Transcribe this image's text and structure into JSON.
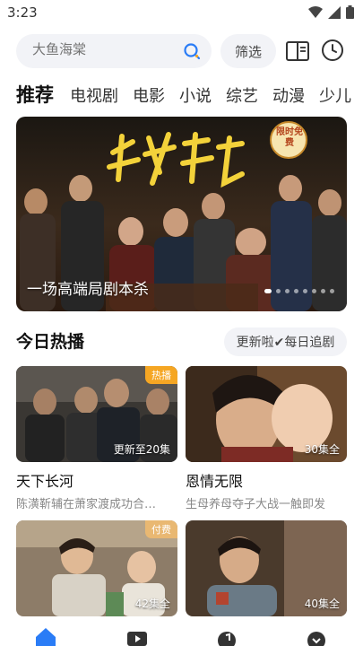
{
  "status": {
    "time": "3:23"
  },
  "search": {
    "placeholder": "大鱼海棠"
  },
  "toolbar": {
    "filter_label": "筛选"
  },
  "tabs": [
    {
      "label": "推荐",
      "active": true
    },
    {
      "label": "电视剧"
    },
    {
      "label": "电影"
    },
    {
      "label": "小说"
    },
    {
      "label": "综艺"
    },
    {
      "label": "动漫"
    },
    {
      "label": "少儿"
    }
  ],
  "banner": {
    "title_art": "扬名立万",
    "badge": "限时免费",
    "caption": "一场高端局剧本杀"
  },
  "section": {
    "title": "今日热播",
    "action_label": "更新啦✔每日追剧"
  },
  "cards": [
    {
      "title": "天下长河",
      "desc": "陈潢靳辅在萧家渡成功合…",
      "badge": "热播",
      "badge_color": "#f5a623",
      "episodes": "更新至20集"
    },
    {
      "title": "恩情无限",
      "desc": "生母养母夺子大战一触即发",
      "badge": "",
      "episodes": "30集全"
    },
    {
      "title": "",
      "desc": "",
      "badge": "付费",
      "badge_color": "#e9b872",
      "episodes": "42集全"
    },
    {
      "title": "",
      "desc": "",
      "badge": "",
      "episodes": "40集全"
    }
  ],
  "colors": {
    "accent": "#2a7cf6",
    "badge_hot": "#f5a623"
  },
  "nav_icons": [
    "home-icon",
    "video-icon",
    "music-icon",
    "profile-icon"
  ]
}
